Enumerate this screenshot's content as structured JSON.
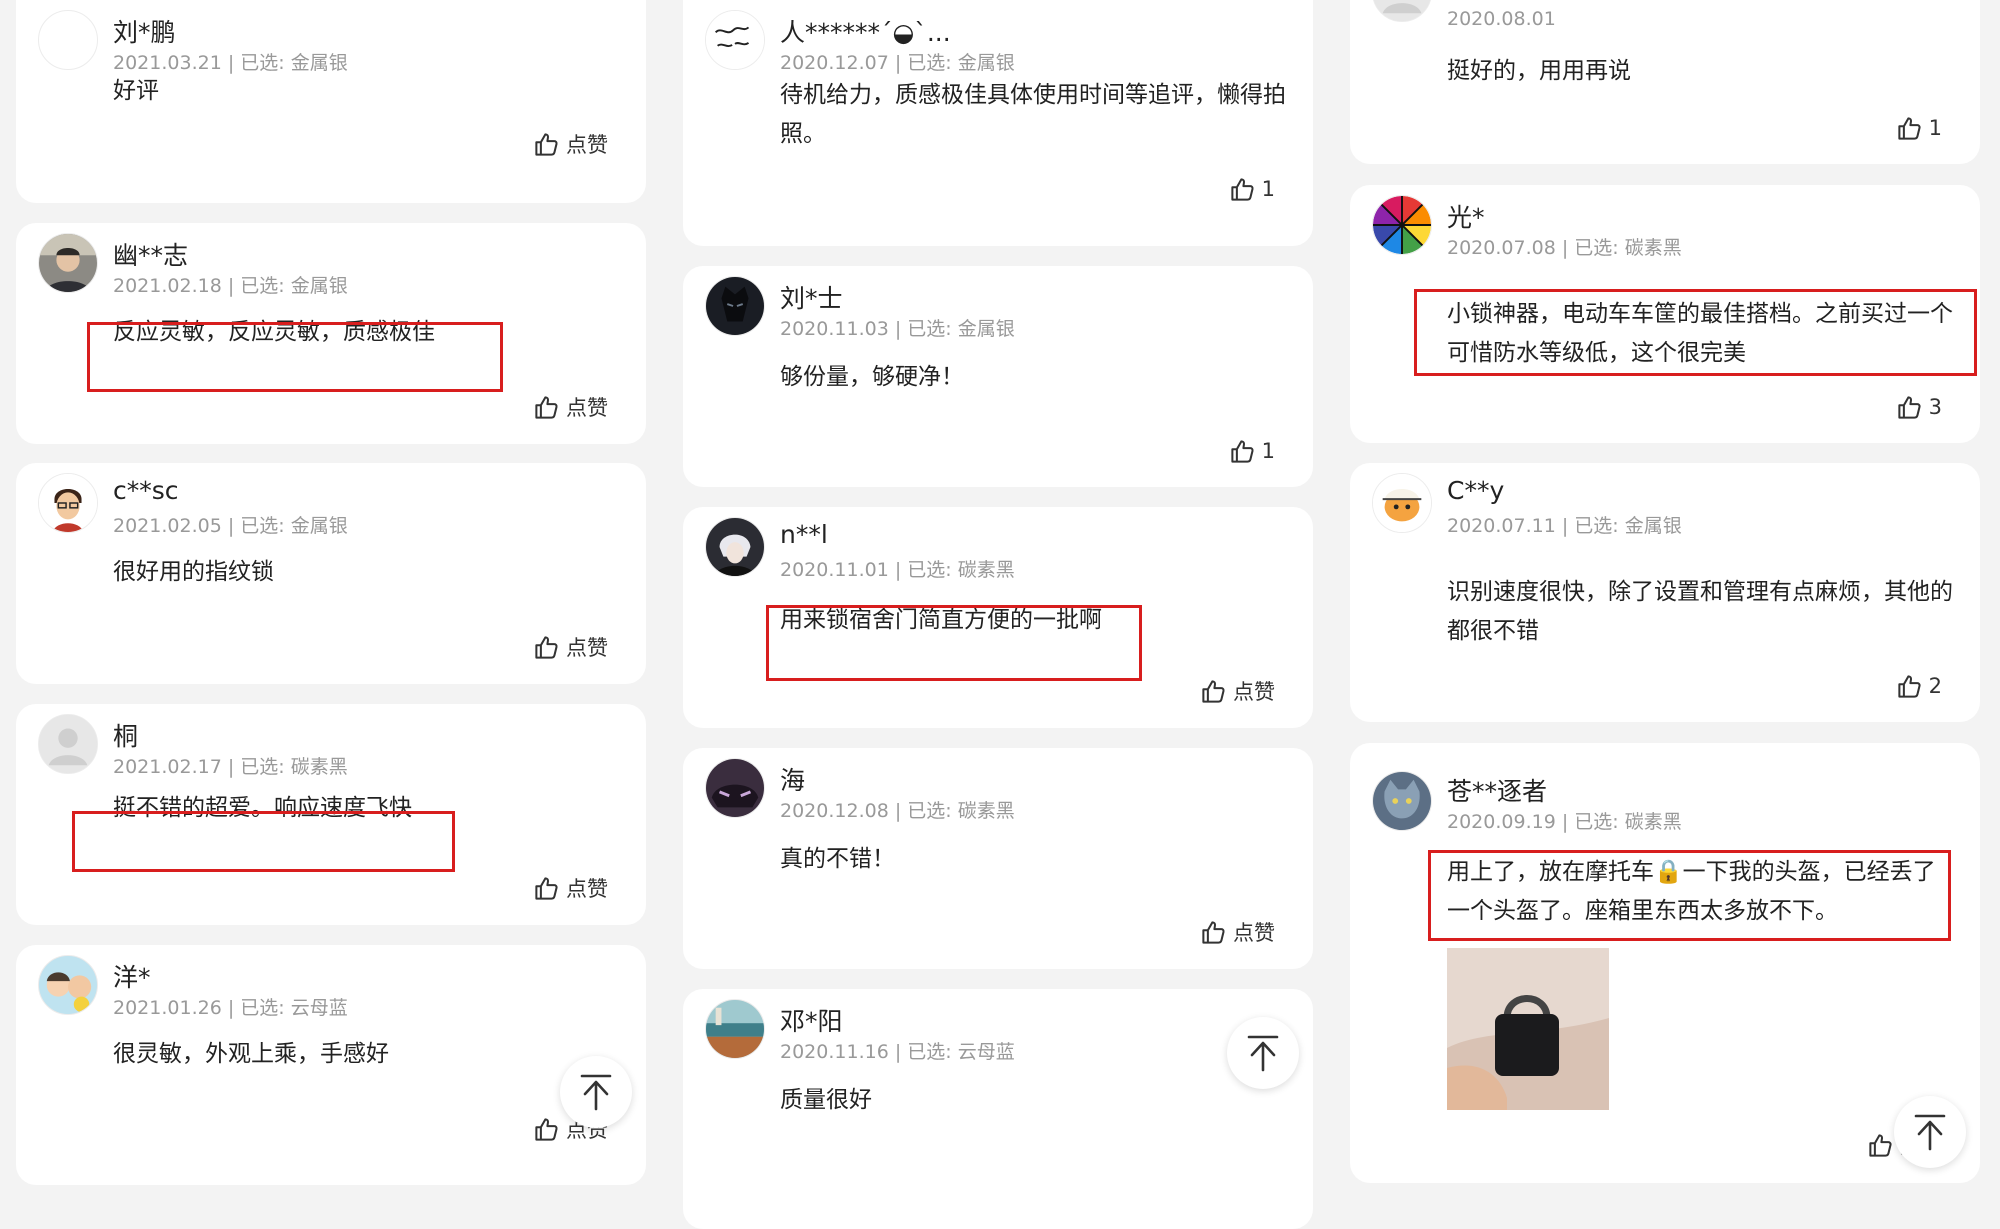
{
  "reviews": {
    "r1": {
      "user": "刘*鹏",
      "meta": "2021.03.21 | 已选: 金属银",
      "text": "好评",
      "likes": "点赞"
    },
    "r2": {
      "user": "幽**志",
      "meta": "2021.02.18 | 已选: 金属银",
      "text": "反应灵敏，反应灵敏，质感极佳",
      "likes": "点赞"
    },
    "r3": {
      "user": "c**sc",
      "meta": "2021.02.05 | 已选: 金属银",
      "text": "很好用的指纹锁",
      "likes": "点赞"
    },
    "r4": {
      "user": "桐",
      "meta": "2021.02.17 | 已选: 碳素黑",
      "text": "挺不错的超爱。响应速度飞快",
      "likes": "点赞"
    },
    "r5": {
      "user": "洋*",
      "meta": "2021.01.26 | 已选: 云母蓝",
      "text": "很灵敏，外观上乘，手感好",
      "likes": "点赞"
    },
    "r6": {
      "user": "人******´◒`...",
      "meta": "2020.12.07 | 已选: 金属银",
      "text": "待机给力，质感极佳具体使用时间等追评，懒得拍照。",
      "likes": "1"
    },
    "r7": {
      "user": "刘*士",
      "meta": "2020.11.03 | 已选: 金属银",
      "text": "够份量，够硬净！",
      "likes": "1"
    },
    "r8": {
      "user": "n**l",
      "meta": "2020.11.01 | 已选: 碳素黑",
      "text": "用来锁宿舍门简直方便的一批啊",
      "likes": "点赞"
    },
    "r9": {
      "user": "海",
      "meta": "2020.12.08 | 已选: 碳素黑",
      "text": "真的不错！",
      "likes": "点赞"
    },
    "r10": {
      "user": "邓*阳",
      "meta": "2020.11.16 | 已选: 云母蓝",
      "text": "质量很好",
      "likes": ""
    },
    "r11": {
      "user": "",
      "meta": "2020.08.01",
      "text": "挺好的，用用再说",
      "likes": "1"
    },
    "r12": {
      "user": "光*",
      "meta": "2020.07.08 | 已选: 碳素黑",
      "text": "小锁神器，电动车车筐的最佳搭档。之前买过一个可惜防水等级低，这个很完美",
      "likes": "3"
    },
    "r13": {
      "user": "C**y",
      "meta": "2020.07.11 | 已选: 金属银",
      "text": "识别速度很快，除了设置和管理有点麻烦，其他的都很不错",
      "likes": "2"
    },
    "r14": {
      "user": "苍**逐者",
      "meta": "2020.09.19 | 已选: 碳素黑",
      "text": "用上了，放在摩托车🔒一下我的头盔，已经丢了一个头盔了。座箱里东西太多放不下。",
      "likes": "点赞"
    }
  },
  "icons": {
    "like": "thumbs-up-icon",
    "back_to_top": "arrow-up-to-top-icon"
  },
  "colors": {
    "highlight": "#d81e1e",
    "background": "#f3f3f3",
    "card": "#ffffff",
    "meta_text": "#999999"
  }
}
